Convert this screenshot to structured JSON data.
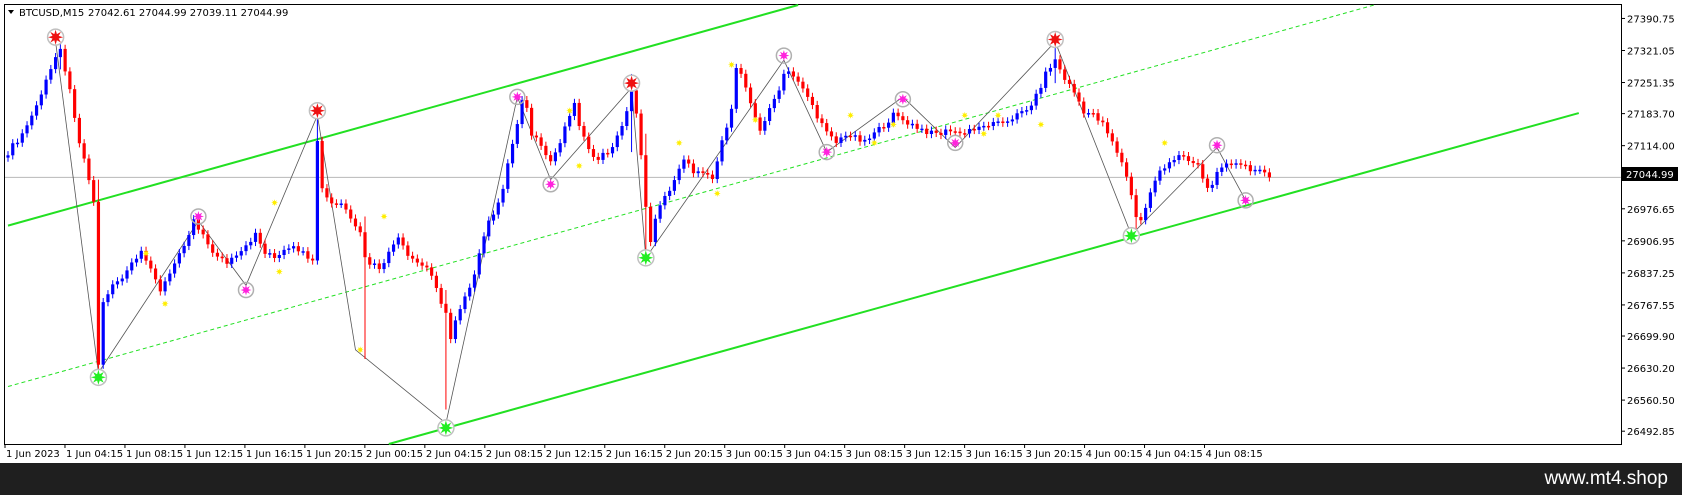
{
  "header": {
    "menu_icon": "triangle-down-icon",
    "symbol": "BTCUSD,M15",
    "ohlc": "27042.61 27044.99 27039.11 27044.99"
  },
  "price_marker": "27044.99",
  "watermark": "www.mt4.shop",
  "colors": {
    "bull": "#0000ff",
    "bear": "#ff0000",
    "channel": "#22e022",
    "midline": "#22e022",
    "zigzag": "#555555",
    "high_marker": "#ee1111",
    "low_marker": "#22ee22",
    "swing_star": "#ff22dd",
    "minor_star": "#ffee00",
    "background": "#ffffff"
  },
  "chart_data": {
    "type": "candlestick",
    "ylim": [
      26465,
      27420
    ],
    "y_ticks": [
      "27390.75",
      "27321.05",
      "27251.35",
      "27183.70",
      "27114.00",
      "27044.99",
      "26976.65",
      "26906.95",
      "26837.25",
      "26767.55",
      "26699.90",
      "26630.20",
      "26560.50",
      "26492.85"
    ],
    "x_labels": [
      "1 Jun 2023",
      "1 Jun 04:15",
      "1 Jun 08:15",
      "1 Jun 12:15",
      "1 Jun 16:15",
      "1 Jun 20:15",
      "2 Jun 00:15",
      "2 Jun 04:15",
      "2 Jun 08:15",
      "2 Jun 12:15",
      "2 Jun 16:15",
      "2 Jun 20:15",
      "3 Jun 00:15",
      "3 Jun 04:15",
      "3 Jun 08:15",
      "3 Jun 12:15",
      "3 Jun 16:15",
      "3 Jun 20:15",
      "4 Jun 00:15",
      "4 Jun 04:15",
      "4 Jun 08:15"
    ],
    "last_price": 27044.99,
    "price_path": [
      [
        0,
        27100
      ],
      [
        3,
        27140
      ],
      [
        6,
        27200
      ],
      [
        8,
        27260
      ],
      [
        10,
        27300
      ],
      [
        11,
        27320
      ],
      [
        12,
        27280
      ],
      [
        13,
        27230
      ],
      [
        14,
        27170
      ],
      [
        15,
        27120
      ],
      [
        16,
        27080
      ],
      [
        17,
        27040
      ],
      [
        18,
        26990
      ],
      [
        19,
        26640
      ],
      [
        20,
        26770
      ],
      [
        21,
        26790
      ],
      [
        22,
        26810
      ],
      [
        24,
        26830
      ],
      [
        26,
        26860
      ],
      [
        28,
        26890
      ],
      [
        30,
        26840
      ],
      [
        32,
        26800
      ],
      [
        34,
        26840
      ],
      [
        37,
        26890
      ],
      [
        39,
        26950
      ],
      [
        40,
        26930
      ],
      [
        42,
        26900
      ],
      [
        44,
        26870
      ],
      [
        46,
        26860
      ],
      [
        48,
        26880
      ],
      [
        50,
        26900
      ],
      [
        52,
        26920
      ],
      [
        54,
        26880
      ],
      [
        56,
        26870
      ],
      [
        58,
        26890
      ],
      [
        60,
        26900
      ],
      [
        62,
        26880
      ],
      [
        64,
        26870
      ],
      [
        65,
        27130
      ],
      [
        66,
        27020
      ],
      [
        68,
        26990
      ],
      [
        70,
        26990
      ],
      [
        72,
        26960
      ],
      [
        74,
        26930
      ],
      [
        75,
        26870
      ],
      [
        76,
        26860
      ],
      [
        78,
        26850
      ],
      [
        80,
        26880
      ],
      [
        82,
        26920
      ],
      [
        84,
        26880
      ],
      [
        86,
        26860
      ],
      [
        88,
        26850
      ],
      [
        90,
        26800
      ],
      [
        92,
        26750
      ],
      [
        93,
        26690
      ],
      [
        94,
        26730
      ],
      [
        96,
        26780
      ],
      [
        98,
        26840
      ],
      [
        100,
        26920
      ],
      [
        102,
        26970
      ],
      [
        104,
        27020
      ],
      [
        106,
        27120
      ],
      [
        107,
        27160
      ],
      [
        108,
        27210
      ],
      [
        109,
        27190
      ],
      [
        110,
        27140
      ],
      [
        112,
        27120
      ],
      [
        114,
        27080
      ],
      [
        116,
        27120
      ],
      [
        118,
        27180
      ],
      [
        119,
        27200
      ],
      [
        120,
        27160
      ],
      [
        122,
        27100
      ],
      [
        124,
        27090
      ],
      [
        126,
        27100
      ],
      [
        128,
        27130
      ],
      [
        130,
        27190
      ],
      [
        131,
        27230
      ],
      [
        132,
        27180
      ],
      [
        133,
        27100
      ],
      [
        134,
        26980
      ],
      [
        135,
        26900
      ],
      [
        136,
        26960
      ],
      [
        138,
        27000
      ],
      [
        140,
        27040
      ],
      [
        142,
        27080
      ],
      [
        144,
        27060
      ],
      [
        146,
        27050
      ],
      [
        148,
        27040
      ],
      [
        150,
        27120
      ],
      [
        152,
        27200
      ],
      [
        153,
        27280
      ],
      [
        154,
        27270
      ],
      [
        156,
        27200
      ],
      [
        158,
        27150
      ],
      [
        160,
        27190
      ],
      [
        162,
        27240
      ],
      [
        163,
        27270
      ],
      [
        164,
        27280
      ],
      [
        166,
        27250
      ],
      [
        168,
        27220
      ],
      [
        170,
        27180
      ],
      [
        172,
        27140
      ],
      [
        174,
        27120
      ],
      [
        176,
        27140
      ],
      [
        178,
        27130
      ],
      [
        180,
        27120
      ],
      [
        182,
        27140
      ],
      [
        184,
        27160
      ],
      [
        186,
        27180
      ],
      [
        188,
        27170
      ],
      [
        190,
        27160
      ],
      [
        192,
        27150
      ],
      [
        194,
        27140
      ],
      [
        196,
        27140
      ],
      [
        198,
        27150
      ],
      [
        200,
        27140
      ],
      [
        202,
        27150
      ],
      [
        204,
        27150
      ],
      [
        206,
        27160
      ],
      [
        208,
        27160
      ],
      [
        210,
        27170
      ],
      [
        212,
        27180
      ],
      [
        214,
        27190
      ],
      [
        216,
        27220
      ],
      [
        218,
        27270
      ],
      [
        220,
        27300
      ],
      [
        222,
        27260
      ],
      [
        224,
        27230
      ],
      [
        226,
        27190
      ],
      [
        228,
        27180
      ],
      [
        230,
        27160
      ],
      [
        232,
        27120
      ],
      [
        234,
        27080
      ],
      [
        236,
        27010
      ],
      [
        237,
        26960
      ],
      [
        238,
        26950
      ],
      [
        240,
        27010
      ],
      [
        242,
        27060
      ],
      [
        244,
        27080
      ],
      [
        246,
        27090
      ],
      [
        248,
        27080
      ],
      [
        250,
        27070
      ],
      [
        252,
        27020
      ],
      [
        254,
        27050
      ],
      [
        256,
        27070
      ],
      [
        258,
        27080
      ],
      [
        260,
        27070
      ],
      [
        262,
        27060
      ],
      [
        264,
        27050
      ],
      [
        265,
        27045
      ]
    ],
    "spikes": [
      {
        "i": 11,
        "low": 27280,
        "high": 27360
      },
      {
        "i": 19,
        "low": 26620,
        "high": 27040
      },
      {
        "i": 65,
        "low": 26900,
        "high": 27190
      },
      {
        "i": 75,
        "low": 26650,
        "high": 26960
      },
      {
        "i": 92,
        "low": 26540,
        "high": 26800
      },
      {
        "i": 131,
        "low": 27100,
        "high": 27270
      },
      {
        "i": 134,
        "low": 26880,
        "high": 27140
      },
      {
        "i": 220,
        "low": 27250,
        "high": 27340
      },
      {
        "i": 237,
        "low": 26930,
        "high": 27020
      }
    ],
    "channel": {
      "upper": [
        [
          0,
          26940
        ],
        [
          166,
          27420
        ]
      ],
      "lower": [
        [
          80,
          26465
        ],
        [
          330,
          27185
        ]
      ],
      "middle": [
        [
          0,
          26590
        ],
        [
          287,
          27420
        ]
      ]
    },
    "zigzag": [
      [
        10,
        27340
      ],
      [
        19,
        26620
      ],
      [
        40,
        26950
      ],
      [
        50,
        26810
      ],
      [
        65,
        27180
      ],
      [
        73,
        26670
      ],
      [
        92,
        26510
      ],
      [
        107,
        27220
      ],
      [
        114,
        27040
      ],
      [
        131,
        27240
      ],
      [
        134,
        26870
      ],
      [
        163,
        27300
      ],
      [
        172,
        27100
      ],
      [
        188,
        27220
      ],
      [
        199,
        27110
      ],
      [
        220,
        27340
      ],
      [
        236,
        26920
      ],
      [
        254,
        27110
      ],
      [
        260,
        26995
      ]
    ],
    "swing_highs": [
      [
        10,
        27350
      ],
      [
        65,
        27190
      ],
      [
        131,
        27250
      ],
      [
        220,
        27345
      ]
    ],
    "swing_lows": [
      [
        19,
        26610
      ],
      [
        92,
        26500
      ],
      [
        134,
        26870
      ],
      [
        236,
        26918
      ]
    ],
    "stars": [
      [
        40,
        26960
      ],
      [
        50,
        26800
      ],
      [
        107,
        27220
      ],
      [
        114,
        27030
      ],
      [
        163,
        27310
      ],
      [
        172,
        27100
      ],
      [
        188,
        27215
      ],
      [
        199,
        27120
      ],
      [
        254,
        27115
      ],
      [
        260,
        26995
      ]
    ],
    "minor_stars": [
      [
        29,
        26880
      ],
      [
        33,
        26770
      ],
      [
        56,
        26990
      ],
      [
        57,
        26840
      ],
      [
        74,
        26670
      ],
      [
        79,
        26960
      ],
      [
        118,
        27190
      ],
      [
        120,
        27070
      ],
      [
        141,
        27120
      ],
      [
        149,
        27010
      ],
      [
        152,
        27290
      ],
      [
        157,
        27170
      ],
      [
        177,
        27180
      ],
      [
        182,
        27120
      ],
      [
        186,
        27160
      ],
      [
        201,
        27180
      ],
      [
        205,
        27140
      ],
      [
        208,
        27180
      ],
      [
        217,
        27160
      ],
      [
        243,
        27120
      ]
    ]
  }
}
